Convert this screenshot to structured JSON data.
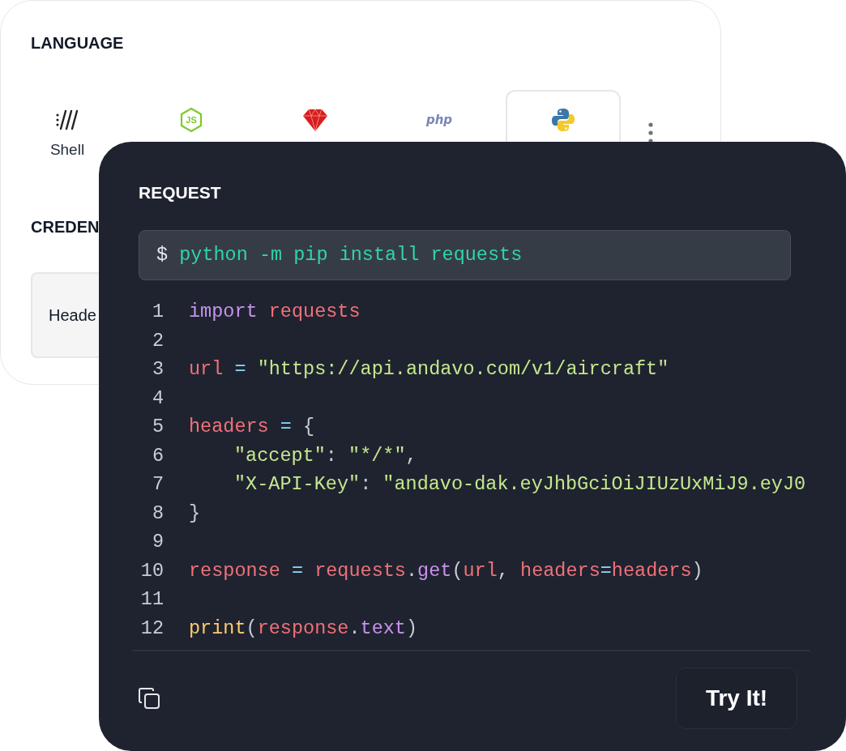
{
  "language_panel": {
    "title": "LANGUAGE",
    "tabs": [
      {
        "kind": "shell",
        "label": "Shell",
        "selected": false
      },
      {
        "kind": "node",
        "logo_text": "JS",
        "selected": false
      },
      {
        "kind": "ruby",
        "selected": false
      },
      {
        "kind": "php",
        "logo_text": "php",
        "selected": false
      },
      {
        "kind": "python",
        "selected": true
      }
    ],
    "credentials_title": "CREDEN",
    "header_field": "Heade"
  },
  "request_panel": {
    "title": "REQUEST",
    "install": {
      "prompt": "$",
      "command": "python -m pip install requests"
    },
    "lines": [
      {
        "number": "1",
        "tokens": [
          {
            "kind": "keyword",
            "text": "import"
          },
          {
            "kind": "name",
            "text": " requests"
          }
        ]
      },
      {
        "number": "2"
      },
      {
        "number": "3",
        "tokens": [
          {
            "kind": "name",
            "text": "url"
          },
          {
            "kind": "operator",
            "text": " = "
          },
          {
            "kind": "string",
            "text": "\"https://api.andavo.com/v1/aircraft\""
          }
        ]
      },
      {
        "number": "4"
      },
      {
        "number": "5",
        "tokens": [
          {
            "kind": "name",
            "text": "headers"
          },
          {
            "kind": "operator",
            "text": " = "
          },
          {
            "kind": "plain",
            "text": "{"
          }
        ]
      },
      {
        "number": "6",
        "indent": true,
        "tokens": [
          {
            "kind": "string",
            "text": "\"accept\""
          },
          {
            "kind": "plain",
            "text": ": "
          },
          {
            "kind": "string",
            "text": "\"*/*\""
          },
          {
            "kind": "plain",
            "text": ","
          }
        ]
      },
      {
        "number": "7",
        "indent": true,
        "tokens": [
          {
            "kind": "string",
            "text": "\"X-API-Key\""
          },
          {
            "kind": "plain",
            "text": ": "
          },
          {
            "kind": "string",
            "text": "\"andavo-dak.eyJhbGciOiJIUzUxMiJ9.eyJ0"
          }
        ]
      },
      {
        "number": "8",
        "tokens": [
          {
            "kind": "plain",
            "text": "}"
          }
        ]
      },
      {
        "number": "9"
      },
      {
        "number": "10",
        "tokens": [
          {
            "kind": "name",
            "text": "response"
          },
          {
            "kind": "operator",
            "text": " = "
          },
          {
            "kind": "name",
            "text": "requests"
          },
          {
            "kind": "plain",
            "text": "."
          },
          {
            "kind": "method",
            "text": "get"
          },
          {
            "kind": "plain",
            "text": "("
          },
          {
            "kind": "name",
            "text": "url"
          },
          {
            "kind": "plain",
            "text": ", "
          },
          {
            "kind": "name",
            "text": "headers"
          },
          {
            "kind": "operator",
            "text": "="
          },
          {
            "kind": "name",
            "text": "headers"
          },
          {
            "kind": "plain",
            "text": ")"
          }
        ]
      },
      {
        "number": "11"
      },
      {
        "number": "12",
        "tokens": [
          {
            "kind": "function",
            "text": "print"
          },
          {
            "kind": "plain",
            "text": "("
          },
          {
            "kind": "name",
            "text": "response"
          },
          {
            "kind": "plain",
            "text": "."
          },
          {
            "kind": "method",
            "text": "text"
          },
          {
            "kind": "plain",
            "text": ")"
          }
        ]
      }
    ],
    "try_button": "Try It!"
  }
}
